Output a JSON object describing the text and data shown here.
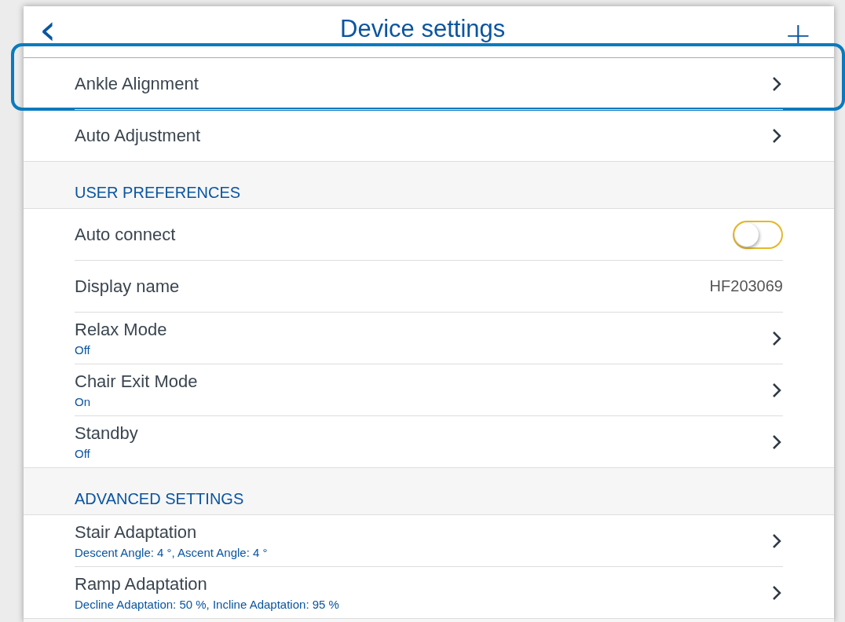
{
  "header": {
    "back": "‹",
    "title": "Device settings",
    "add": "+"
  },
  "sections": [
    {
      "rows": [
        {
          "kind": "chevron",
          "label": "Ankle Alignment",
          "highlighted": true
        },
        {
          "kind": "chevron",
          "label": "Auto Adjustment",
          "highlighted": false
        }
      ]
    },
    {
      "title": "USER PREFERENCES",
      "rows": [
        {
          "kind": "toggle",
          "label": "Auto connect",
          "on": false,
          "highlighted": false
        },
        {
          "kind": "value",
          "label": "Display name",
          "value": "HF203069",
          "highlighted": false
        },
        {
          "kind": "chevron",
          "label": "Relax Mode",
          "subtitle": "Off",
          "highlighted": false
        },
        {
          "kind": "chevron",
          "label": "Chair Exit Mode",
          "subtitle": "On",
          "highlighted": false
        },
        {
          "kind": "chevron",
          "label": "Standby",
          "subtitle": "Off",
          "highlighted": false
        }
      ]
    },
    {
      "title": "ADVANCED SETTINGS",
      "rows": [
        {
          "kind": "chevron",
          "label": "Stair Adaptation",
          "subtitle": "Descent Angle: 4 °, Ascent Angle: 4 °",
          "highlighted": false
        },
        {
          "kind": "chevron",
          "label": "Ramp Adaptation",
          "subtitle": "Decline Adaptation: 50 %, Incline Adaptation: 95 %",
          "highlighted": false
        }
      ]
    }
  ]
}
